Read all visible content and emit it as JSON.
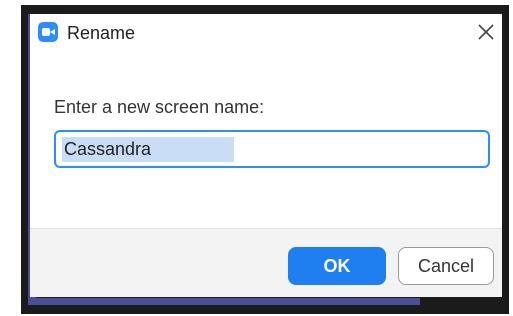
{
  "dialog": {
    "title": "Rename",
    "app_icon": "zoom-video-camera-icon",
    "close_icon": "close-icon",
    "prompt": "Enter a new screen name:",
    "input": {
      "value": "Cassandra",
      "selected": true
    },
    "buttons": {
      "ok_label": "OK",
      "cancel_label": "Cancel"
    }
  },
  "colors": {
    "accent": "#1f7ff0",
    "input_border": "#2d8cff",
    "selection": "#c9ddf6",
    "footer_bg": "#f3f3f3",
    "backdrop_strip": "#4a4f9a"
  }
}
